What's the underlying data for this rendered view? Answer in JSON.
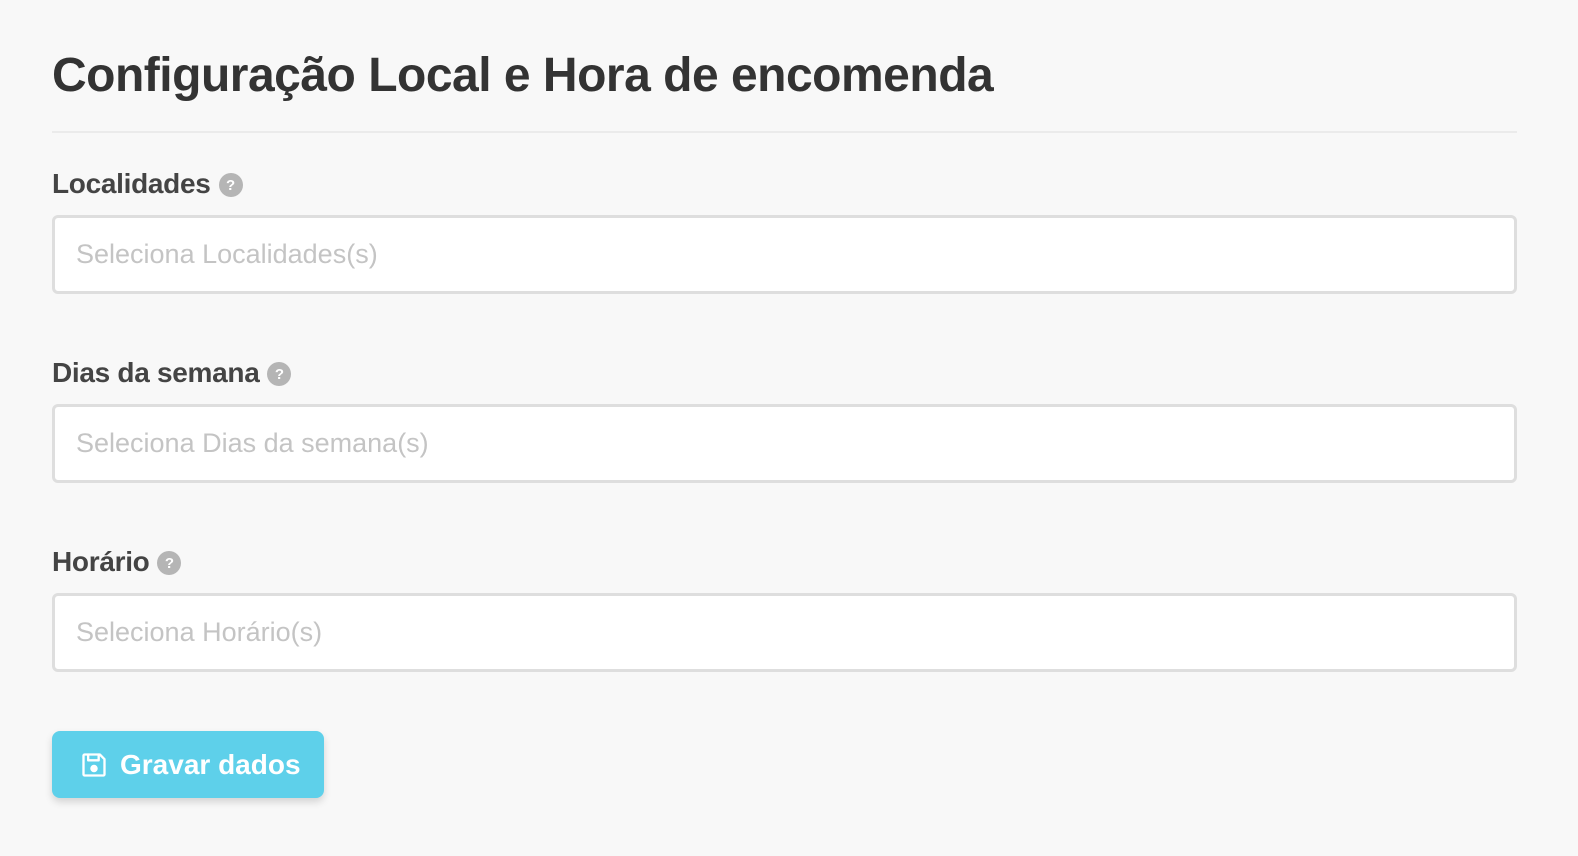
{
  "page": {
    "title": "Configuração Local e Hora de encomenda"
  },
  "fields": [
    {
      "label": "Localidades",
      "help_icon": "?",
      "placeholder": "Seleciona Localidades(s)",
      "value": ""
    },
    {
      "label": "Dias da semana",
      "help_icon": "?",
      "placeholder": "Seleciona Dias da semana(s)",
      "value": ""
    },
    {
      "label": "Horário",
      "help_icon": "?",
      "placeholder": "Seleciona Horário(s)",
      "value": ""
    }
  ],
  "actions": {
    "save_label": "Gravar dados",
    "save_icon": "floppy-disk-icon",
    "save_color": "#5ed0ea"
  },
  "colors": {
    "background": "#f8f8f8",
    "text": "#333333",
    "input_border": "#dedede",
    "placeholder": "#c4c4c4",
    "help_icon_bg": "#b5b5b5"
  }
}
